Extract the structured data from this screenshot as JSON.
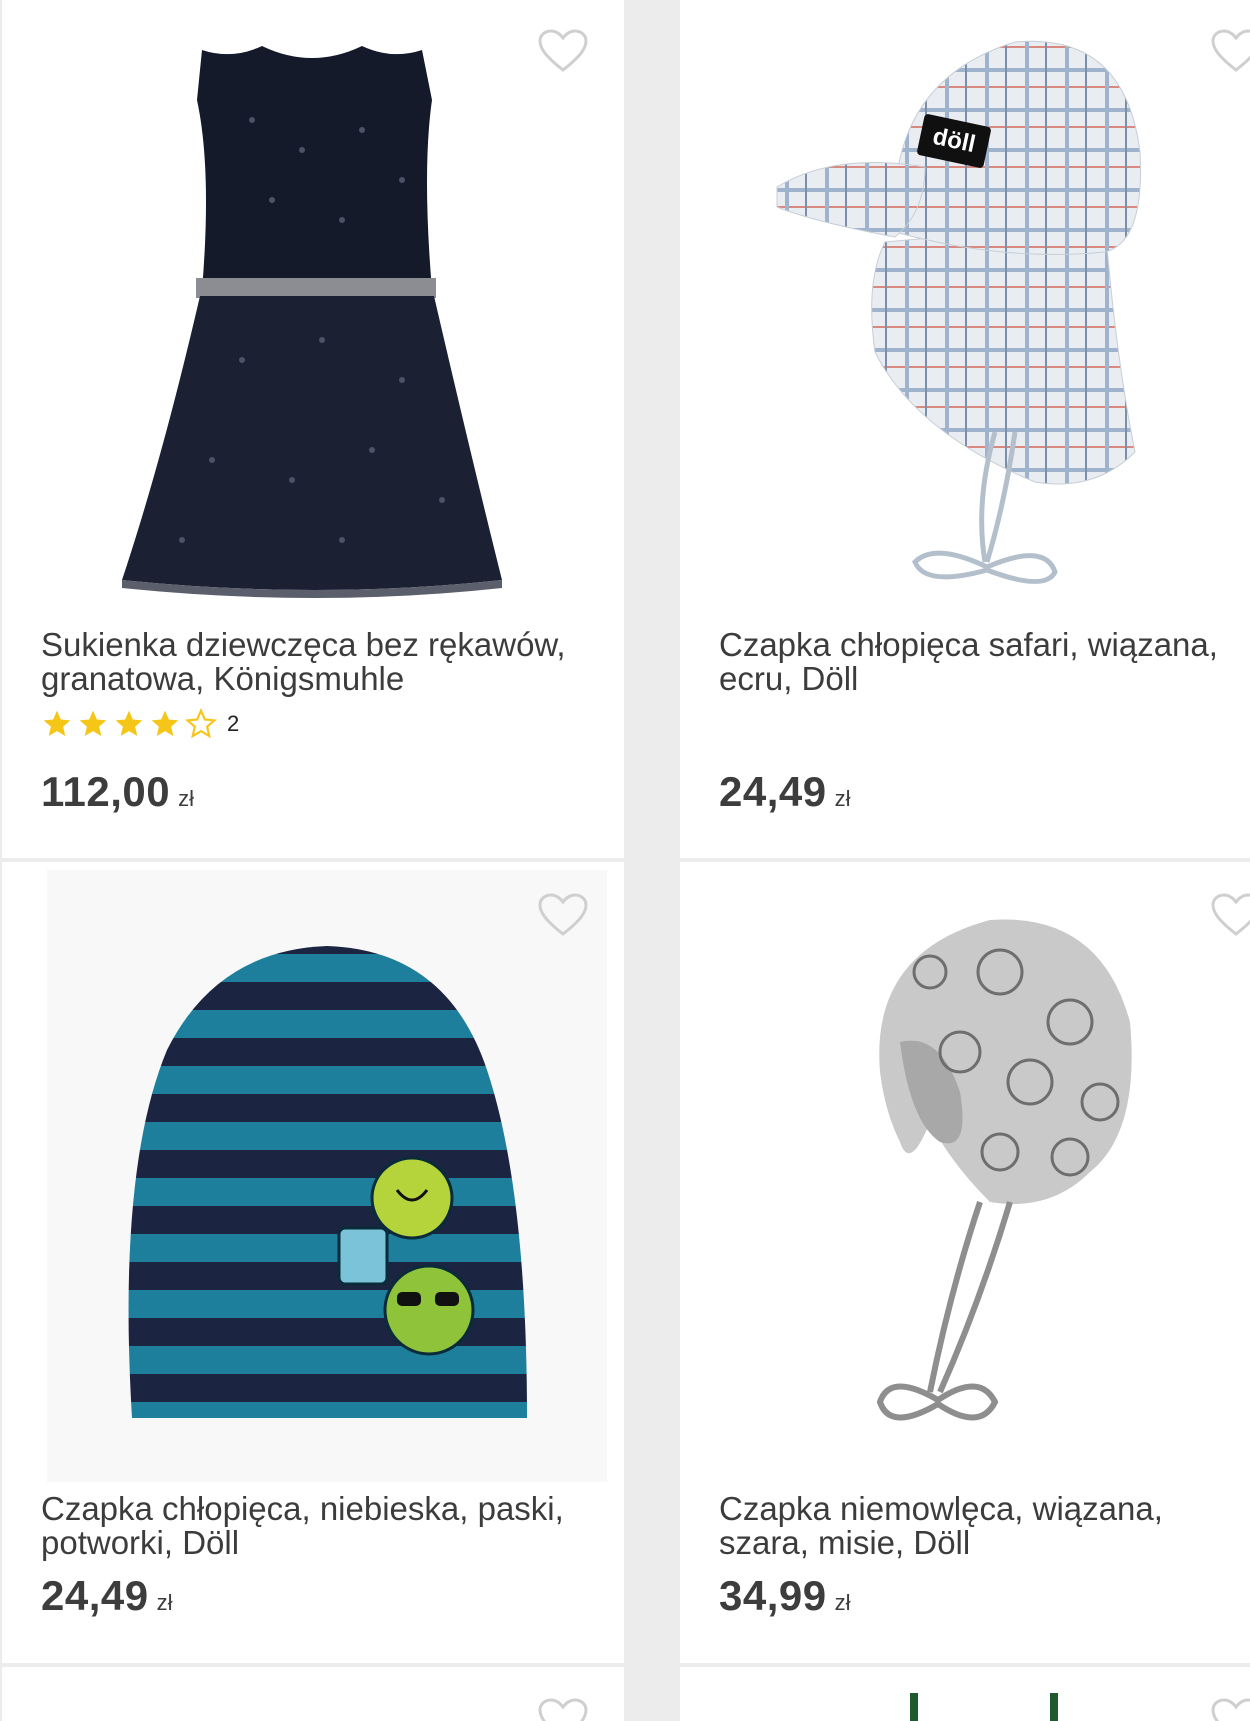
{
  "products": [
    {
      "title_lines": [
        "Sukienka dziewczęca bez rękawów,",
        "granatowa, Königsmuhle"
      ],
      "rating": 4,
      "rating_max": 5,
      "review_count": "2",
      "price": "112,00",
      "currency": "zł"
    },
    {
      "title_lines": [
        "Czapka chłopięca safari, wiązana,",
        "ecru, Döll"
      ],
      "price": "24,49",
      "currency": "zł",
      "brand_label": "döll"
    },
    {
      "title_lines": [
        "Czapka chłopięca, niebieska, paski,",
        "potworki, Döll"
      ],
      "price": "24,49",
      "currency": "zł"
    },
    {
      "title_lines": [
        "Czapka niemowlęca, wiązana,",
        "szara, misie, Döll"
      ],
      "price": "34,99",
      "currency": "zł"
    }
  ],
  "colors": {
    "star": "#f5c518",
    "heart_outline": "#cfcfcf",
    "background": "#ececec",
    "card": "#ffffff"
  },
  "icons": {
    "favorite": "heart-outline-icon",
    "star_filled": "star-filled-icon",
    "star_empty": "star-outline-icon"
  }
}
